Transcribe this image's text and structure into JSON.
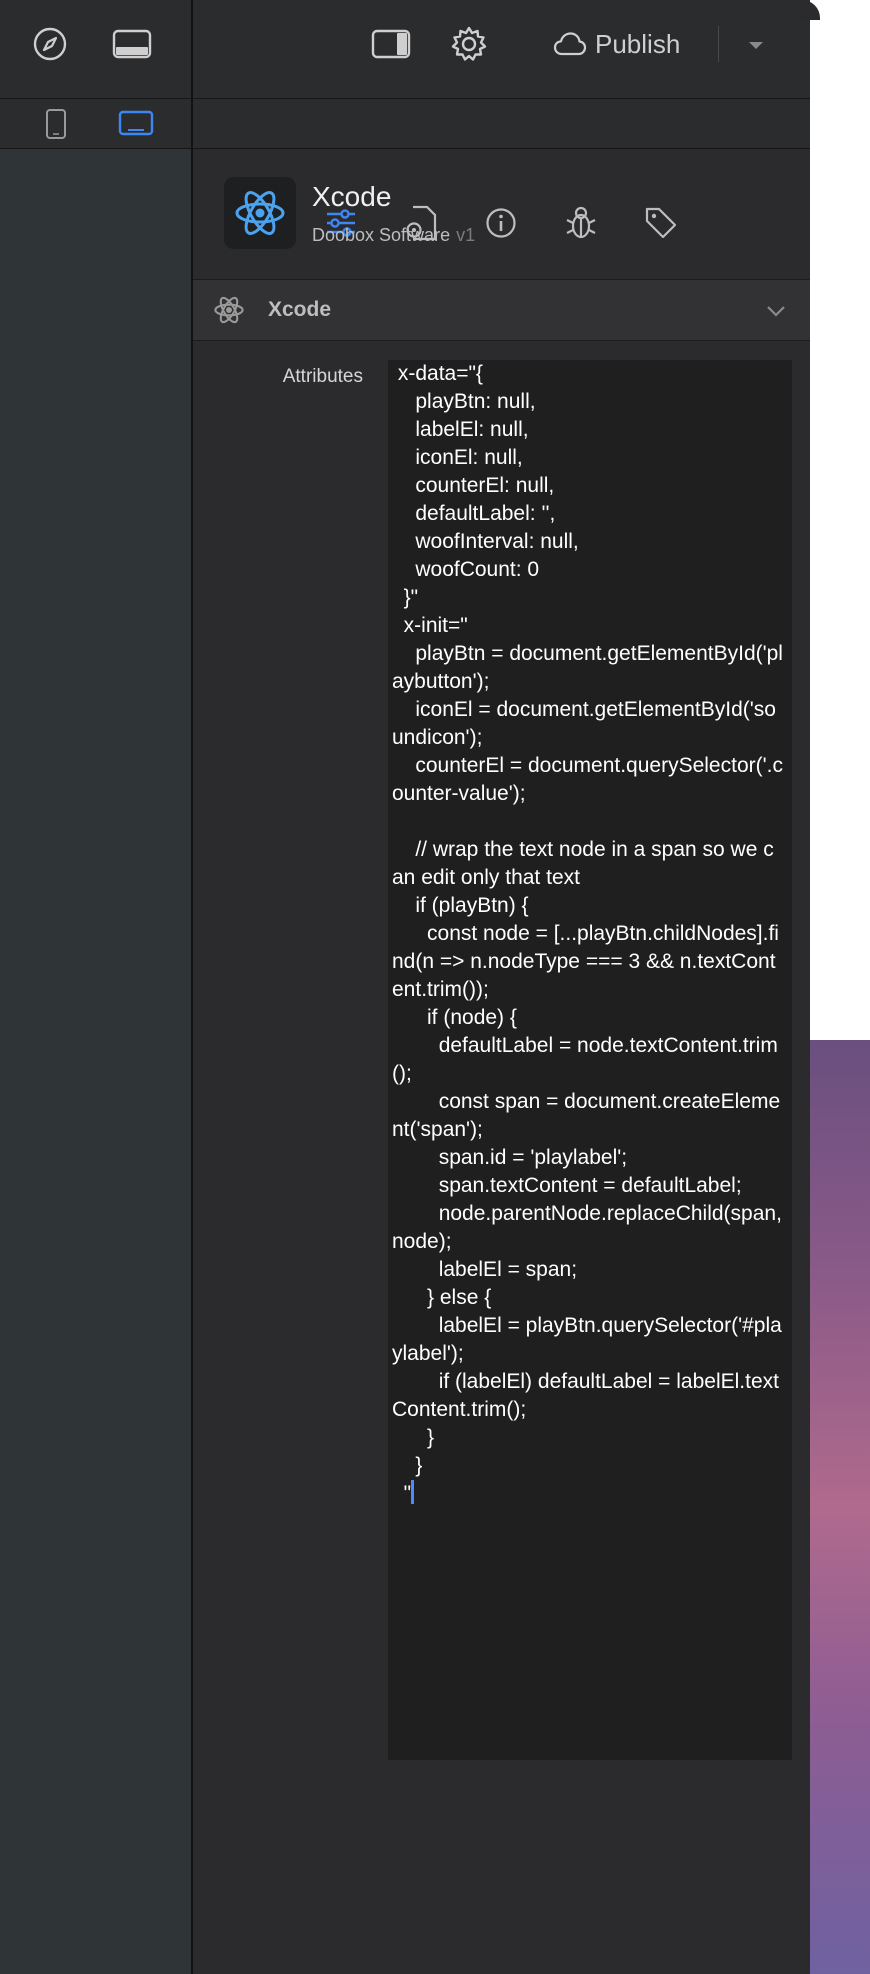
{
  "toolbar": {
    "publish_label": "Publish",
    "icons": [
      "compass-icon",
      "bottom-panel-icon",
      "right-panel-icon",
      "gear-icon",
      "cloud-icon",
      "chevron-down-icon"
    ]
  },
  "device_tabs": [
    "phone-icon",
    "laptop-icon"
  ],
  "inspector_tabs": [
    "sliders-icon",
    "file-gear-icon",
    "info-icon",
    "bug-icon",
    "tag-icon"
  ],
  "app": {
    "name": "Xcode",
    "vendor": "Doobox Software",
    "version": "v1"
  },
  "section": {
    "title": "Xcode"
  },
  "attributes": {
    "label": "Attributes",
    "code": " x-data=\"{\n    playBtn: null,\n    labelEl: null,\n    iconEl: null,\n    counterEl: null,\n    defaultLabel: '',\n    woofInterval: null,\n    woofCount: 0\n  }\"\n  x-init=\"\n    playBtn = document.getElementById('playbutton');\n    iconEl = document.getElementById('soundicon');\n    counterEl = document.querySelector('.counter-value');\n\n    // wrap the text node in a span so we can edit only that text\n    if (playBtn) {\n      const node = [...playBtn.childNodes].find(n => n.nodeType === 3 && n.textContent.trim());\n      if (node) {\n        defaultLabel = node.textContent.trim();\n        const span = document.createElement('span');\n        span.id = 'playlabel';\n        span.textContent = defaultLabel;\n        node.parentNode.replaceChild(span, node);\n        labelEl = span;\n      } else {\n        labelEl = playBtn.querySelector('#playlabel');\n        if (labelEl) defaultLabel = labelEl.textContent.trim();\n      }\n    }\n  \""
  },
  "colors": {
    "accent": "#4a8cff",
    "app_icon": "#4ba3f0",
    "panel_bg": "#2b2b2d",
    "code_bg": "#1f1f1f"
  }
}
